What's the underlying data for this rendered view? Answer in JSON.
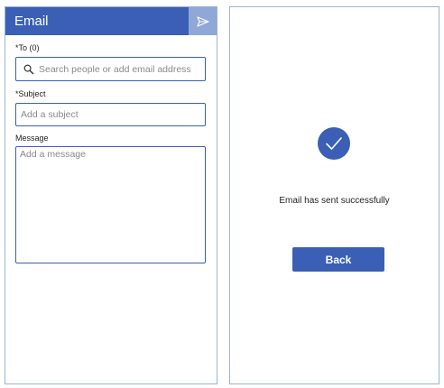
{
  "compose": {
    "title": "Email",
    "to_label": "*To (0)",
    "to_placeholder": "Search people or add email address",
    "subject_label": "*Subject",
    "subject_placeholder": "Add a subject",
    "message_label": "Message",
    "message_placeholder": "Add a message",
    "send_icon": "send-icon"
  },
  "success": {
    "icon": "checkmark-icon",
    "message": "Email has sent successfully",
    "back_label": "Back"
  },
  "colors": {
    "accent": "#3a5fb5",
    "send_button_bg": "#8fa8d8",
    "panel_border": "#9bb4d6"
  }
}
